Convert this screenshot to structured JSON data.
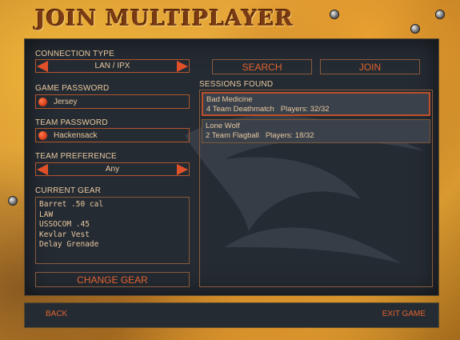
{
  "title": "JOIN MULTIPLAYER",
  "connection": {
    "label": "CONNECTION TYPE",
    "value": "LAN / IPX"
  },
  "game_password": {
    "label": "GAME PASSWORD",
    "value": "Jersey"
  },
  "team_password": {
    "label": "TEAM PASSWORD",
    "value": "Hackensack"
  },
  "team_preference": {
    "label": "TEAM PREFERENCE",
    "value": "Any"
  },
  "gear": {
    "label": "CURRENT GEAR",
    "items": [
      "Barret .50 cal",
      "LAW",
      "USSOCOM .45",
      "Kevlar Vest",
      "Delay Grenade"
    ],
    "change_label": "CHANGE GEAR"
  },
  "actions": {
    "search_label": "SEARCH",
    "join_label": "JOIN"
  },
  "sessions": {
    "label": "SESSIONS FOUND",
    "items": [
      {
        "name": "Bad Medicine",
        "mode": "4 Team Deathmatch",
        "players_label": "Players:",
        "players": "32/32",
        "selected": true
      },
      {
        "name": "Lone Wolf",
        "mode": "2 Team Flagball",
        "players_label": "Players:",
        "players": "18/32",
        "selected": false
      }
    ]
  },
  "footer": {
    "back_label": "BACK",
    "exit_label": "EXIT GAME"
  },
  "colors": {
    "accent": "#e0632f",
    "text": "#e8c9a0",
    "panel": "#252b33",
    "border": "#b0562a"
  }
}
